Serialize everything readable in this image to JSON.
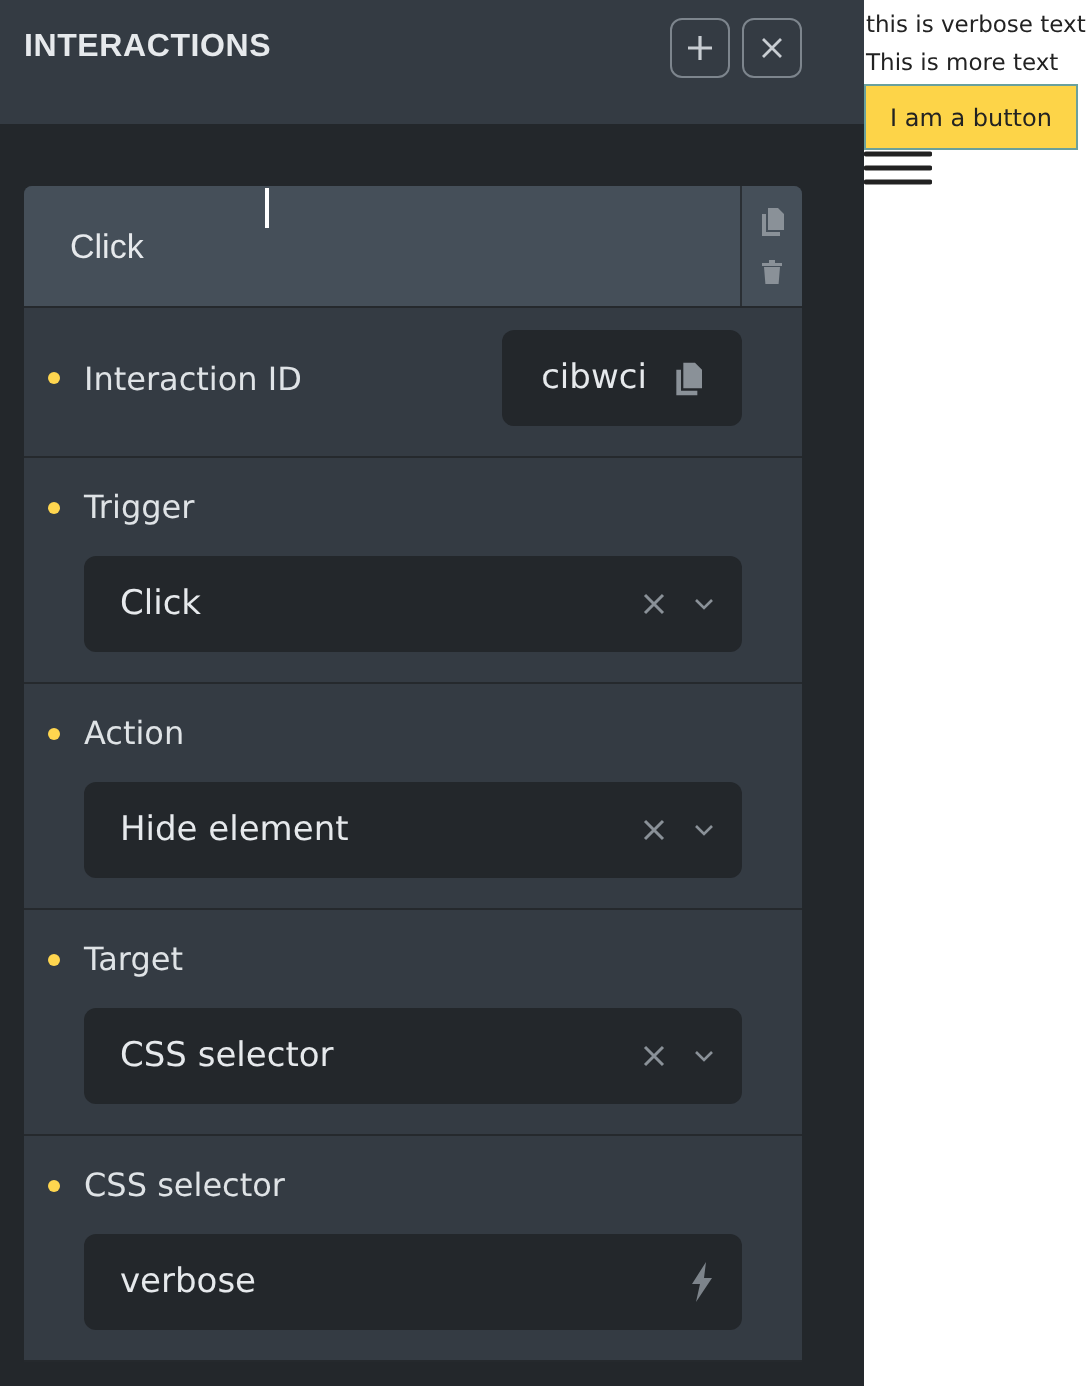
{
  "panel": {
    "title": "INTERACTIONS"
  },
  "interaction": {
    "title": "Click",
    "fields": [
      {
        "kind": "id",
        "label": "Interaction ID",
        "value": "cibwci"
      },
      {
        "kind": "select",
        "label": "Trigger",
        "value": "Click"
      },
      {
        "kind": "select",
        "label": "Action",
        "value": "Hide element"
      },
      {
        "kind": "select",
        "label": "Target",
        "value": "CSS selector"
      },
      {
        "kind": "text",
        "label": "CSS selector",
        "value": "verbose"
      }
    ]
  },
  "preview": {
    "texts": [
      "this is verbose text",
      "This is more text"
    ],
    "button": "I am a button"
  }
}
